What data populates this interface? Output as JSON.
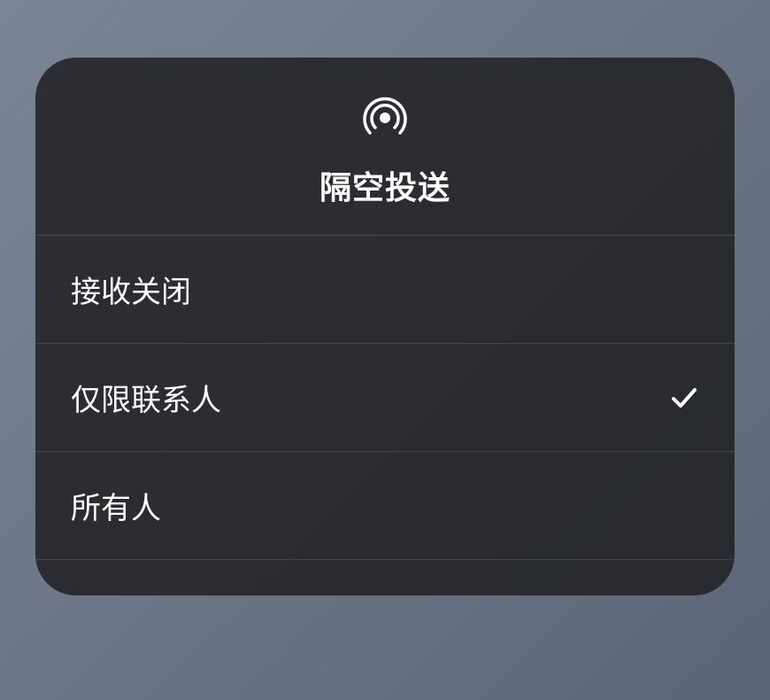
{
  "header": {
    "title": "隔空投送",
    "icon": "airdrop-icon"
  },
  "options": [
    {
      "label": "接收关闭",
      "selected": false
    },
    {
      "label": "仅限联系人",
      "selected": true
    },
    {
      "label": "所有人",
      "selected": false
    }
  ]
}
